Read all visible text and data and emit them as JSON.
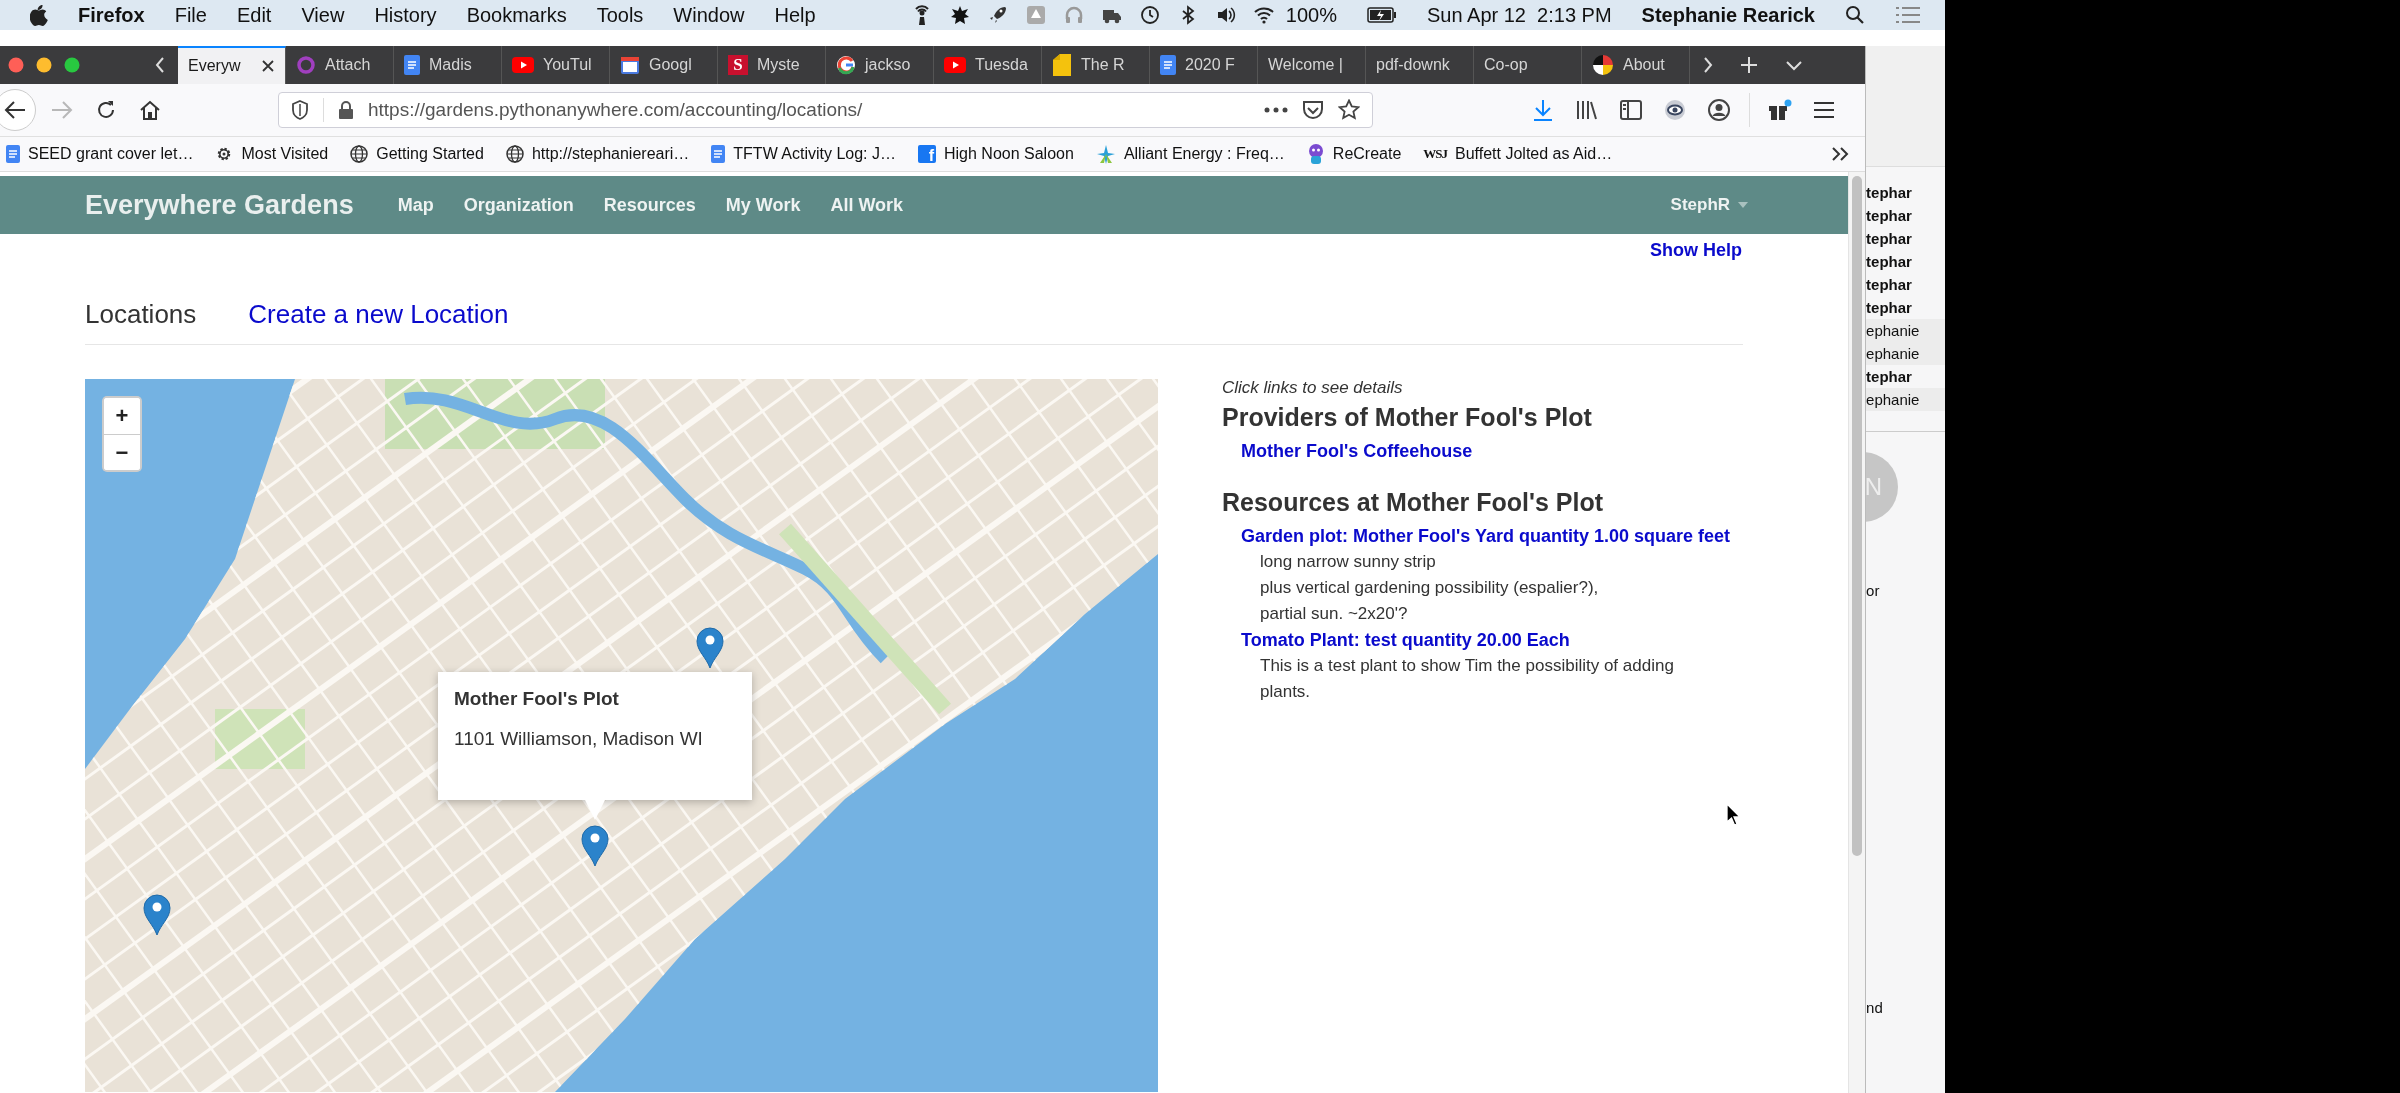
{
  "menu_bar": {
    "app_name": "Firefox",
    "menus": [
      "File",
      "Edit",
      "View",
      "History",
      "Bookmarks",
      "Tools",
      "Window",
      "Help"
    ],
    "battery": "100%",
    "clock": "Sun Apr 12  2:13 PM",
    "user": "Stephanie Rearick"
  },
  "tabs": [
    {
      "label": "Everyw",
      "kind": "none",
      "selected": true
    },
    {
      "label": "Attach",
      "kind": "ring",
      "selected": false
    },
    {
      "label": "Madis",
      "kind": "doc",
      "selected": false
    },
    {
      "label": "YouTul",
      "kind": "video",
      "selected": false
    },
    {
      "label": "Googl",
      "kind": "calendar",
      "selected": false
    },
    {
      "label": "Myste",
      "kind": "logo",
      "logo": "S",
      "selected": false
    },
    {
      "label": "jackso",
      "kind": "google",
      "selected": false
    },
    {
      "label": "Tuesda",
      "kind": "video",
      "selected": false
    },
    {
      "label": "The R",
      "kind": "note",
      "selected": false
    },
    {
      "label": "2020 F",
      "kind": "doc",
      "selected": false
    },
    {
      "label": "Welcome |",
      "kind": "none",
      "selected": false
    },
    {
      "label": "pdf-downk",
      "kind": "none",
      "selected": false
    },
    {
      "label": "Co-op",
      "kind": "none",
      "selected": false
    },
    {
      "label": "About",
      "kind": "wheel",
      "selected": false
    }
  ],
  "navigation": {
    "back_disabled": false,
    "forward_disabled": true,
    "url": "https://gardens.pythonanywhere.com/accounting/locations/"
  },
  "bookmarks": [
    {
      "label": "SEED grant cover let…",
      "kind": "doc"
    },
    {
      "label": "Most Visited",
      "kind": "gear"
    },
    {
      "label": "Getting Started",
      "kind": "globe"
    },
    {
      "label": "http://stephaniereari…",
      "kind": "globe"
    },
    {
      "label": "TFTW Activity Log: J…",
      "kind": "doc"
    },
    {
      "label": "High Noon Saloon",
      "kind": "logo",
      "logo": "f"
    },
    {
      "label": "Alliant Energy : Freq…",
      "kind": "spark"
    },
    {
      "label": "ReCreate",
      "kind": "mascot"
    },
    {
      "label": "Buffett Jolted as Aid…",
      "kind": "logo_text",
      "logo": "WSJ"
    }
  ],
  "app": {
    "brand": "Everywhere Gardens",
    "nav": [
      "Map",
      "Organization",
      "Resources",
      "My Work",
      "All Work"
    ],
    "user_menu": "StephR",
    "help_link": "Show Help"
  },
  "page": {
    "title": "Locations",
    "create_link": "Create a new Location",
    "map": {
      "zoom_in": "+",
      "zoom_out": "−",
      "popup": {
        "title": "Mother Fool's Plot",
        "address": "1101 Williamson, Madison WI"
      }
    },
    "details": {
      "hint": "Click links to see details",
      "sections": [
        {
          "heading": "Providers of Mother Fool's Plot",
          "items": [
            {
              "link": "Mother Fool's Coffeehouse"
            }
          ]
        },
        {
          "heading": "Resources at Mother Fool's Plot",
          "items": [
            {
              "link": "Garden plot: Mother Fool's Yard quantity 1.00 square feet",
              "notes": [
                "long narrow sunny strip",
                "plus vertical gardening possibility (espalier?),",
                "partial sun. ~2x20'?"
              ]
            },
            {
              "link": "Tomato Plant: test quantity 20.00 Each",
              "notes": [
                "This is a test plant to show Tim the possibility of adding plants."
              ]
            }
          ]
        }
      ]
    }
  },
  "background_window": {
    "rows": [
      {
        "text": "tephar",
        "unread": true
      },
      {
        "text": "tephar",
        "unread": true
      },
      {
        "text": "tephar",
        "unread": true
      },
      {
        "text": "tephar",
        "unread": true
      },
      {
        "text": "tephar",
        "unread": true
      },
      {
        "text": "tephar",
        "unread": true
      },
      {
        "text": "ephanie",
        "unread": false
      },
      {
        "text": "ephanie",
        "unread": false
      },
      {
        "text": "tephar",
        "unread": true
      },
      {
        "text": "ephanie",
        "unread": false
      }
    ],
    "avatar_initial": "N",
    "fragments": [
      "or",
      "nd"
    ]
  }
}
